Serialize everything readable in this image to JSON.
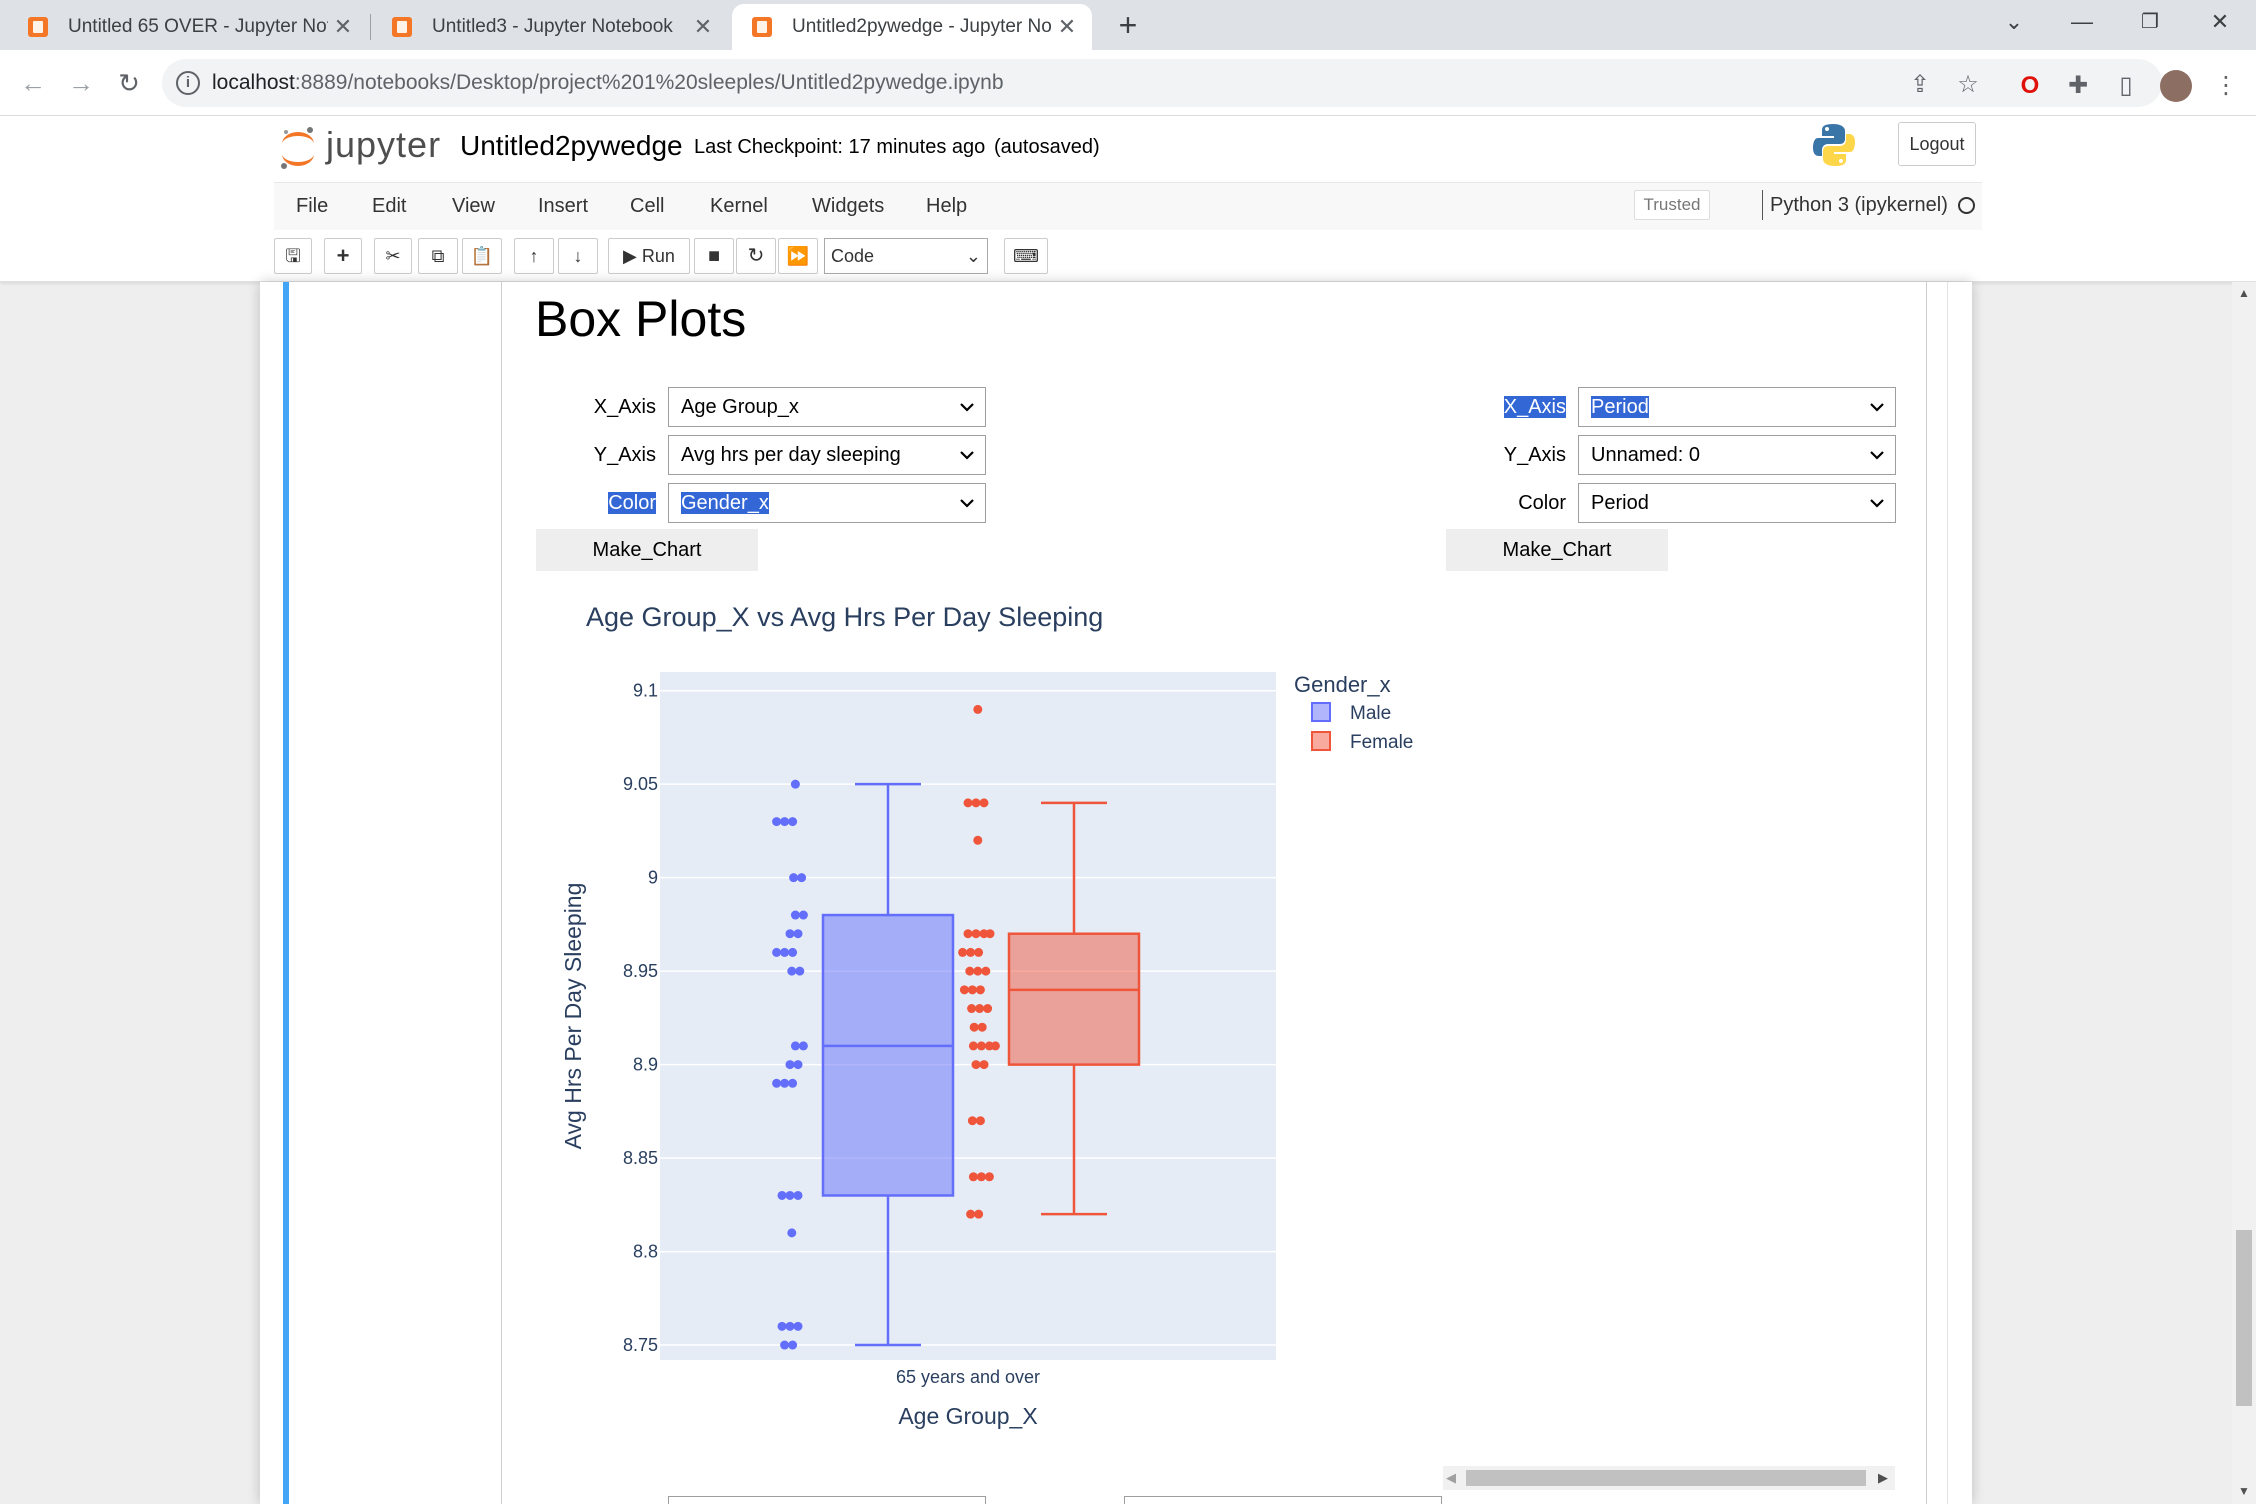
{
  "browser": {
    "tabs": [
      {
        "title": "Untitled 65 OVER - Jupyter Note",
        "active": false
      },
      {
        "title": "Untitled3 - Jupyter Notebook",
        "active": false
      },
      {
        "title": "Untitled2pywedge - Jupyter Not",
        "active": true
      }
    ],
    "new_tab_icon": "plus-icon",
    "url_host": "localhost",
    "url_rest": ":8889/notebooks/Desktop/project%201%20sleeples/Untitled2pywedge.ipynb"
  },
  "jupyter": {
    "logo_text": "jupyter",
    "notebook_name": "Untitled2pywedge",
    "checkpoint": "Last Checkpoint: 17 minutes ago",
    "autosaved": "(autosaved)",
    "logout": "Logout",
    "menu": [
      "File",
      "Edit",
      "View",
      "Insert",
      "Cell",
      "Kernel",
      "Widgets",
      "Help"
    ],
    "trusted": "Trusted",
    "kernel": "Python 3 (ipykernel)",
    "toolbar": {
      "run_label": "Run",
      "cell_type": "Code"
    }
  },
  "cell": {
    "heading": "Box Plots",
    "left_widgets": {
      "x_label": "X_Axis",
      "x_value": "Age Group_x",
      "y_label": "Y_Axis",
      "y_value": "Avg hrs per day sleeping",
      "color_label": "Color",
      "color_value": "Gender_x",
      "button": "Make_Chart"
    },
    "right_widgets": {
      "x_label": "X_Axis",
      "x_value": "Period",
      "y_label": "Y_Axis",
      "y_value": "Unnamed: 0",
      "color_label": "Color",
      "color_value": "Period",
      "button": "Make_Chart"
    }
  },
  "colors": {
    "male": "#636efa",
    "female": "#ef553b",
    "plot_bg": "#e5ecf6",
    "cell_bar": "#42a5f5",
    "selection": "#3367d6"
  },
  "chart_data": {
    "type": "box",
    "title": "Age Group_X vs Avg Hrs Per Day Sleeping",
    "xlabel": "Age Group_X",
    "ylabel": "Avg Hrs Per Day Sleeping",
    "categories": [
      "65 years and over"
    ],
    "ylim": [
      8.742,
      9.11
    ],
    "yticks": [
      8.75,
      8.8,
      8.85,
      8.9,
      8.95,
      9,
      9.05,
      9.1
    ],
    "ytick_labels": [
      "8.75",
      "8.8",
      "8.85",
      "8.9",
      "8.95",
      "9",
      "9.05",
      "9.1"
    ],
    "legend_title": "Gender_x",
    "legend_position": "top-right",
    "grid": true,
    "series": [
      {
        "name": "Male",
        "box": {
          "q1": 8.83,
          "median": 8.91,
          "q3": 8.98,
          "lowerfence": 8.75,
          "upperfence": 9.05
        },
        "points": [
          9.05,
          9.03,
          9.03,
          9.03,
          9.0,
          9.0,
          8.98,
          8.98,
          8.97,
          8.97,
          8.96,
          8.96,
          8.96,
          8.95,
          8.95,
          8.91,
          8.91,
          8.9,
          8.9,
          8.89,
          8.89,
          8.89,
          8.83,
          8.83,
          8.83,
          8.81,
          8.76,
          8.76,
          8.76,
          8.75,
          8.75
        ]
      },
      {
        "name": "Female",
        "box": {
          "q1": 8.9,
          "median": 8.94,
          "q3": 8.97,
          "lowerfence": 8.82,
          "upperfence": 9.04
        },
        "points": [
          9.09,
          9.04,
          9.04,
          9.04,
          9.02,
          8.97,
          8.97,
          8.97,
          8.97,
          8.96,
          8.96,
          8.96,
          8.95,
          8.95,
          8.95,
          8.94,
          8.94,
          8.94,
          8.93,
          8.93,
          8.93,
          8.92,
          8.92,
          8.91,
          8.91,
          8.91,
          8.91,
          8.9,
          8.9,
          8.87,
          8.87,
          8.84,
          8.84,
          8.84,
          8.82,
          8.82
        ]
      }
    ]
  }
}
